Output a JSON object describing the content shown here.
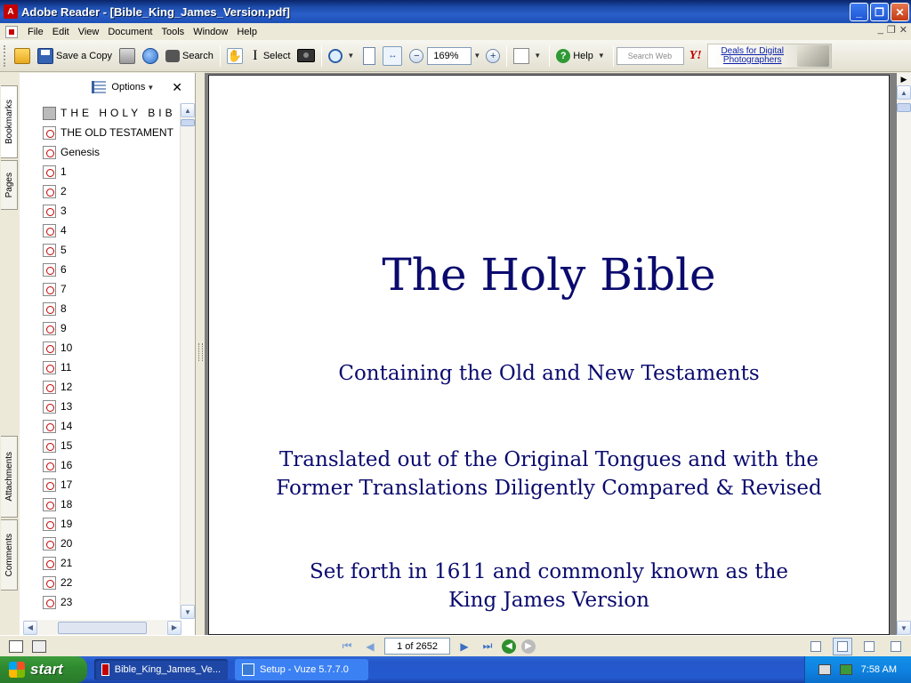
{
  "window": {
    "title": "Adobe Reader - [Bible_King_James_Version.pdf]",
    "app_icon_letter": "A"
  },
  "menu": [
    "File",
    "Edit",
    "View",
    "Document",
    "Tools",
    "Window",
    "Help"
  ],
  "toolbar": {
    "save_copy": "Save a Copy",
    "search": "Search",
    "select": "Select",
    "zoom_value": "169%",
    "help": "Help",
    "search_web_placeholder": "Search Web",
    "yahoo": "Y!",
    "ad_line1": "Deals for Digital",
    "ad_line2": "Photographers"
  },
  "nav_panel": {
    "options": "Options",
    "tabs": [
      "Bookmarks",
      "Pages",
      "Attachments",
      "Comments"
    ],
    "bookmarks": [
      "THE HOLY BIB",
      "THE OLD TESTAMENT",
      "Genesis",
      "1",
      "2",
      "3",
      "4",
      "5",
      "6",
      "7",
      "8",
      "9",
      "10",
      "11",
      "12",
      "13",
      "14",
      "15",
      "16",
      "17",
      "18",
      "19",
      "20",
      "21",
      "22",
      "23"
    ]
  },
  "document": {
    "title": "The Holy Bible",
    "subtitle": "Containing the Old and New Testaments",
    "line2a": "Translated out of the Original Tongues and with the",
    "line2b": "Former Translations Diligently Compared & Revised",
    "line3a": "Set forth in 1611 and commonly known as the",
    "line3b": "King James Version"
  },
  "status": {
    "page_indicator": "1 of 2652"
  },
  "taskbar": {
    "start": "start",
    "tasks": [
      "Bible_King_James_Ve...",
      "Setup - Vuze 5.7.7.0"
    ],
    "time": "7:58 AM"
  }
}
